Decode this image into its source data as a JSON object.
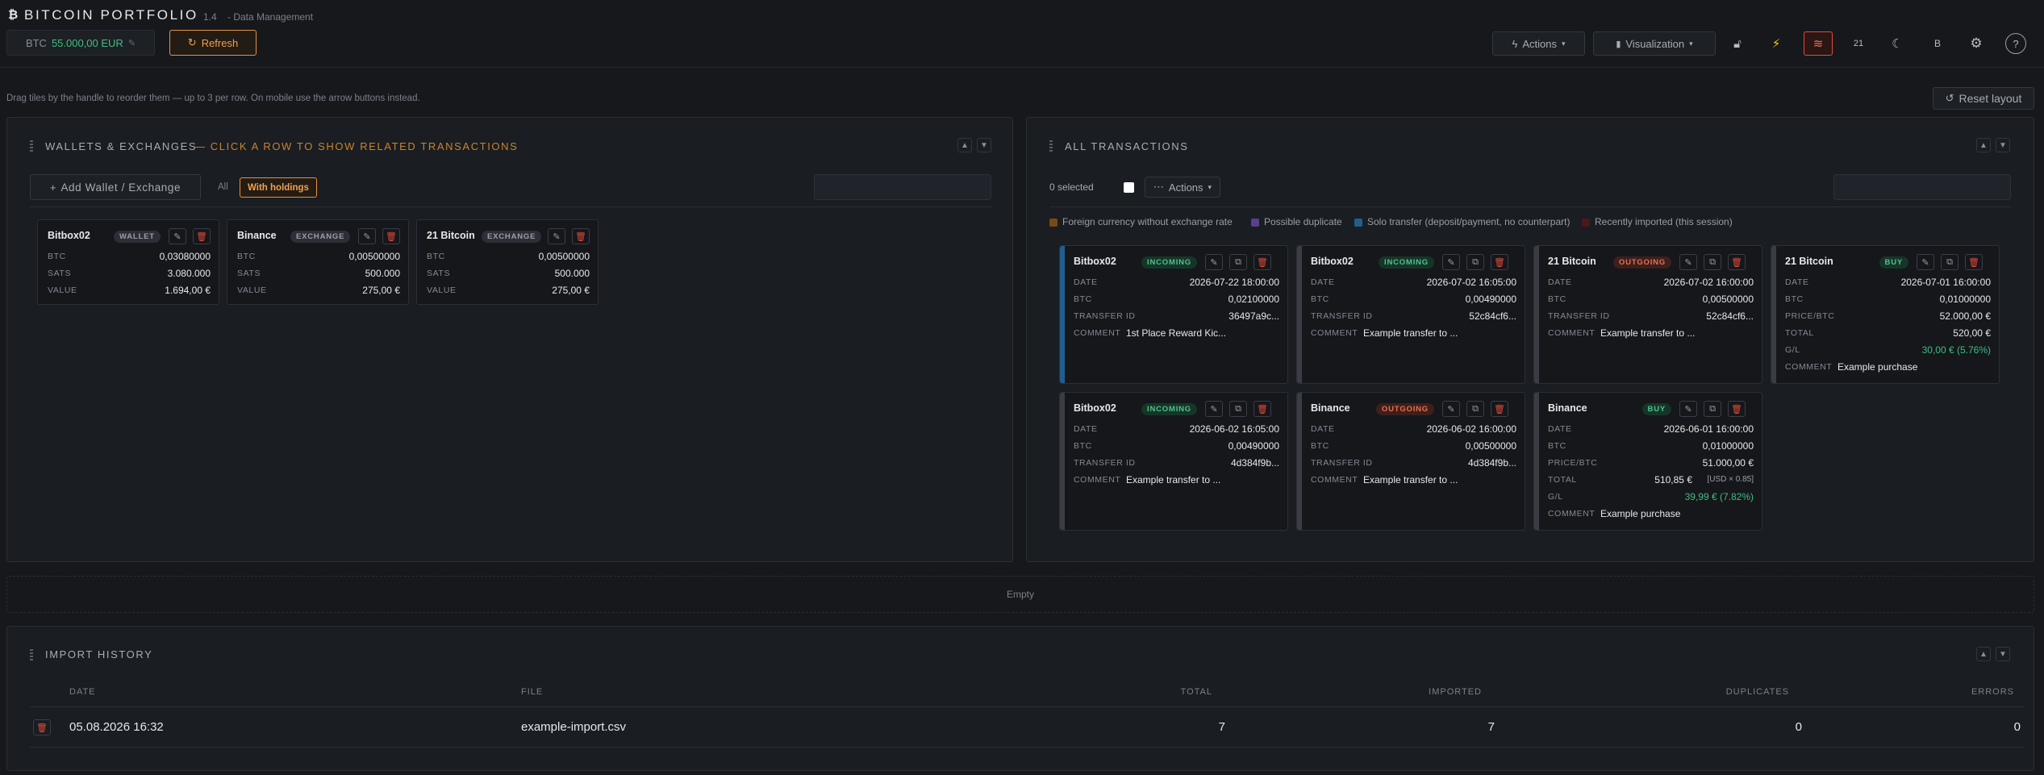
{
  "header": {
    "logo_glyph": "₿",
    "title": "BITCOIN PORTFOLIO",
    "version": "1.4",
    "subtitle": "- Data Management",
    "btc_label": "BTC",
    "btc_price": "55.000,00 EUR",
    "refresh_label": "Refresh",
    "actions_label": "Actions",
    "visualization_label": "Visualization",
    "block_label": "21",
    "b_label": "B"
  },
  "hint": "Drag tiles by the handle to reorder them — up to 3 per row. On mobile use the arrow buttons instead.",
  "reset_layout_label": "Reset layout",
  "wallets": {
    "title": "WALLETS & EXCHANGES",
    "subtitle": "— CLICK A ROW TO SHOW RELATED TRANSACTIONS",
    "add_label": "Add Wallet / Exchange",
    "filter_all": "All",
    "filter_holdings": "With holdings",
    "cards": [
      {
        "name": "Bitbox02",
        "type": "WALLET",
        "rows": [
          {
            "k": "BTC",
            "v": "0,03080000"
          },
          {
            "k": "SATS",
            "v": "3.080.000"
          },
          {
            "k": "VALUE",
            "v": "1.694,00 €"
          }
        ]
      },
      {
        "name": "Binance",
        "type": "EXCHANGE",
        "rows": [
          {
            "k": "BTC",
            "v": "0,00500000"
          },
          {
            "k": "SATS",
            "v": "500.000"
          },
          {
            "k": "VALUE",
            "v": "275,00 €"
          }
        ]
      },
      {
        "name": "21 Bitcoin",
        "type": "EXCHANGE",
        "rows": [
          {
            "k": "BTC",
            "v": "0,00500000"
          },
          {
            "k": "SATS",
            "v": "500.000"
          },
          {
            "k": "VALUE",
            "v": "275,00 €"
          }
        ]
      }
    ]
  },
  "transactions": {
    "title": "ALL TRANSACTIONS",
    "selected": "0 selected",
    "actions_label": "Actions",
    "legend": [
      {
        "label": "Foreign currency without exchange rate",
        "color": "#7a4a14"
      },
      {
        "label": "Possible duplicate",
        "color": "#5a3f8f"
      },
      {
        "label": "Solo transfer (deposit/payment, no counterpart)",
        "color": "#1f5f8f"
      },
      {
        "label": "Recently imported (this session)",
        "color": "#4a1818"
      }
    ],
    "cards": [
      {
        "name": "Bitbox02",
        "type": "INCOMING",
        "rows": [
          {
            "k": "DATE",
            "v": "2026-07-22 18:00:00"
          },
          {
            "k": "BTC",
            "v": "0,02100000"
          },
          {
            "k": "TRANSFER ID",
            "v": "36497a9c..."
          },
          {
            "k": "COMMENT",
            "v": "1st Place Reward Kic..."
          }
        ]
      },
      {
        "name": "Bitbox02",
        "type": "INCOMING",
        "rows": [
          {
            "k": "DATE",
            "v": "2026-07-02 16:05:00"
          },
          {
            "k": "BTC",
            "v": "0,00490000"
          },
          {
            "k": "TRANSFER ID",
            "v": "52c84cf6..."
          },
          {
            "k": "COMMENT",
            "v": "Example transfer to ..."
          }
        ]
      },
      {
        "name": "21 Bitcoin",
        "type": "OUTGOING",
        "rows": [
          {
            "k": "DATE",
            "v": "2026-07-02 16:00:00"
          },
          {
            "k": "BTC",
            "v": "0,00500000"
          },
          {
            "k": "TRANSFER ID",
            "v": "52c84cf6..."
          },
          {
            "k": "COMMENT",
            "v": "Example transfer to ..."
          }
        ]
      },
      {
        "name": "21 Bitcoin",
        "type": "BUY",
        "rows": [
          {
            "k": "DATE",
            "v": "2026-07-01 16:00:00"
          },
          {
            "k": "BTC",
            "v": "0,01000000"
          },
          {
            "k": "PRICE/BTC",
            "v": "52.000,00 €"
          },
          {
            "k": "TOTAL",
            "v": "520,00 €"
          },
          {
            "k": "G/L",
            "v": "30,00 € (5.76%)"
          },
          {
            "k": "COMMENT",
            "v": "Example purchase"
          }
        ]
      },
      {
        "name": "Bitbox02",
        "type": "INCOMING",
        "rows": [
          {
            "k": "DATE",
            "v": "2026-06-02 16:05:00"
          },
          {
            "k": "BTC",
            "v": "0,00490000"
          },
          {
            "k": "TRANSFER ID",
            "v": "4d384f9b..."
          },
          {
            "k": "COMMENT",
            "v": "Example transfer to ..."
          }
        ]
      },
      {
        "name": "Binance",
        "type": "OUTGOING",
        "rows": [
          {
            "k": "DATE",
            "v": "2026-06-02 16:00:00"
          },
          {
            "k": "BTC",
            "v": "0,00500000"
          },
          {
            "k": "TRANSFER ID",
            "v": "4d384f9b..."
          },
          {
            "k": "COMMENT",
            "v": "Example transfer to ..."
          }
        ]
      },
      {
        "name": "Binance",
        "type": "BUY",
        "rows": [
          {
            "k": "DATE",
            "v": "2026-06-01 16:00:00"
          },
          {
            "k": "BTC",
            "v": "0,01000000"
          },
          {
            "k": "PRICE/BTC",
            "v": "51.000,00 €"
          },
          {
            "k": "TOTAL",
            "v": "510,85 €"
          },
          {
            "k": "G/L",
            "v": "39,99 € (7.82%)"
          },
          {
            "k": "COMMENT",
            "v": "Example purchase"
          }
        ]
      }
    ],
    "total_note": "[USD × 0.85]"
  },
  "empty_label": "Empty",
  "import_history": {
    "title": "IMPORT HISTORY",
    "headers": {
      "date": "DATE",
      "file": "FILE",
      "total": "TOTAL",
      "imported": "IMPORTED",
      "duplicates": "DUPLICATES",
      "errors": "ERRORS"
    },
    "rows": [
      {
        "date": "05.08.2026 16:32",
        "file": "example-import.csv",
        "total": "7",
        "imported": "7",
        "duplicates": "0",
        "errors": "0"
      }
    ]
  }
}
